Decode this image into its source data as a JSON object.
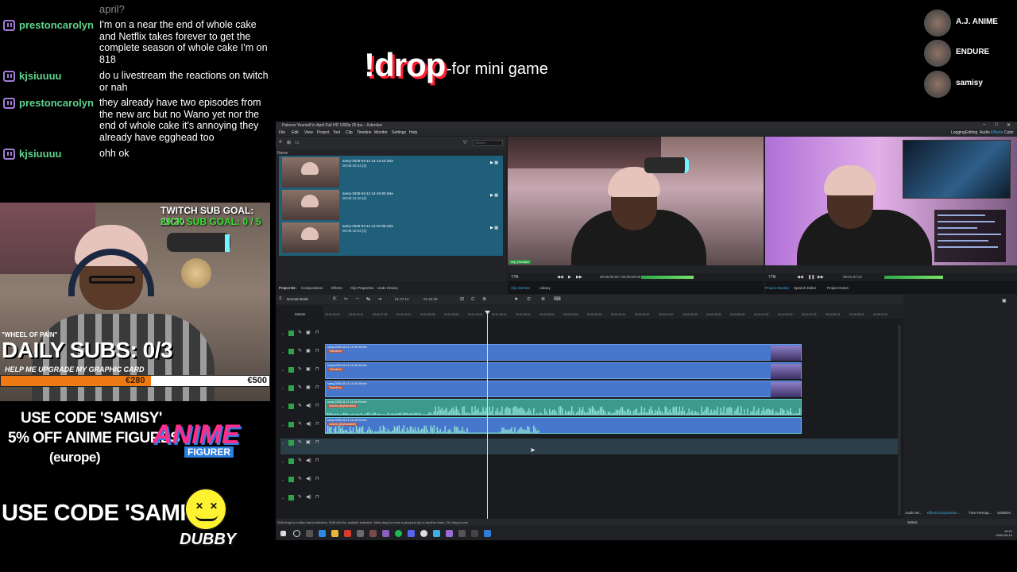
{
  "chat": {
    "faded_text": "april?",
    "messages": [
      {
        "user": "prestoncarolyn",
        "text": "I'm on a near the end of whole cake and Netflix takes forever to get the complete season of whole cake I'm on 818"
      },
      {
        "user": "kjsiuuuu",
        "text": "do u livestream the reactions on twitch or nah"
      },
      {
        "user": "prestoncarolyn",
        "text": "they already have two episodes from the new arc but no Wano yet nor the end of whole cake it's annoying they already have egghead too"
      },
      {
        "user": "kjsiuuuu",
        "text": "ohh ok"
      }
    ]
  },
  "overlay": {
    "twitch_goal": "TWITCH SUB GOAL: 29/30",
    "kick_goal": "KICK SUB GOAL: 0 / 5",
    "wheel_label": "\"WHEEL OF PAIN\"",
    "daily_subs": "DAILY SUBS: 0/3",
    "gpu_label": "HELP ME UPGRADE MY GRAPHIC CARD",
    "gpu_current": "€280",
    "gpu_goal": "€500",
    "gpu_progress": 0.56,
    "promo1_line1": "USE CODE 'SAMISY'",
    "promo1_line2": "5% OFF ANIME FIGURES",
    "promo1_line3": "(europe)",
    "anime_logo": "ANIME",
    "anime_logo_sub": "FIGURER",
    "promo2": "USE CODE 'SAMISY'",
    "dubby_logo": "DUBBY"
  },
  "banner": {
    "command": "!drop",
    "description": "-for mini game"
  },
  "team": [
    {
      "name": "A.J. ANIME"
    },
    {
      "name": "ENDURE"
    },
    {
      "name": "samisy"
    }
  ],
  "editor": {
    "title": "Patreon Yourself in April Full HD 1080p 25 fps – Kdenlive",
    "menu": [
      "File",
      "Edit",
      "View",
      "Project",
      "Tool",
      "Clip",
      "Timeline",
      "Monitor",
      "Settings",
      "Help"
    ],
    "layouts": [
      "Logging",
      "Editing",
      "Audio",
      "Effects",
      "Color"
    ],
    "active_layout": "Effects",
    "search_placeholder": "Search...",
    "bin_header": "Name",
    "bin_items": [
      {
        "name": "samy-2026-04-12 14-13-10.mkv",
        "duration": "00:08:32:24 [4]"
      },
      {
        "name": "samy-2026-04-12 14-15-00.mkv",
        "duration": "00:06:12:10 [4]"
      },
      {
        "name": "samy-2026-04-12 14-04-09.mkv",
        "duration": "00:05:40:02 [4]"
      }
    ],
    "bin_tabs": [
      "Project Bin",
      "Compositions",
      "Effects",
      "Clip Properties",
      "Undo History"
    ],
    "clip_monitor": {
      "zoom": "77fit",
      "timecode": "00:00:00:00 / 00:00:00:00",
      "badge": "clip_Duration"
    },
    "project_monitor": {
      "zoom": "77fit",
      "timecode": "00:01:37:14"
    },
    "monitor_tabs_left": [
      "Clip Monitor",
      "Library"
    ],
    "monitor_tabs_right": [
      "Project Monitor",
      "Speech Editor",
      "Project Notes"
    ],
    "timeline_mode": "Normal Mode",
    "timecodes": [
      "01:37:14",
      "01:32:28"
    ],
    "master_label": "Master",
    "ruler_ticks": [
      "00:00:00:00",
      "00:00:13:11",
      "00:00:27:09",
      "00:00:41:07",
      "00:00:55:05",
      "00:01:09:03",
      "00:01:23:01",
      "00:01:36:24",
      "00:01:50:22",
      "00:02:04:20",
      "00:02:18:18",
      "00:02:32:16",
      "00:02:46:14",
      "00:03:00:12",
      "00:03:14:10",
      "00:03:28:08",
      "00:03:42:06",
      "00:03:56:04",
      "00:04:10:02",
      "00:04:24:00",
      "00:04:37:23",
      "00:04:51:21",
      "00:05:05:19",
      "00:05:19:17"
    ],
    "clips": [
      {
        "name": "samy-2026-04-12 14-04-09.mkv",
        "fx": "Transform"
      },
      {
        "name": "samy-2026-04-12 14-04-09.mkv",
        "fx": "Transform"
      },
      {
        "name": "samy-2026-04-12 14-04-09.mkv",
        "fx": "Transform"
      },
      {
        "name": "samy-2026-04-12 14-04-09.mkv",
        "fx": "Volume (keyframable)"
      },
      {
        "name": "samy-2026-04-12 14-04-09.mkv",
        "fx": "Volume (keyframable)"
      }
    ],
    "right_tabs": [
      "Audio Mi...",
      "Effect/Composition...",
      "Time Remap...",
      "Subtitles"
    ],
    "status": "Shift drag for rubber-band selection, Shift click for multiple selection, Meta drag to move a grouped clip to another track, Ctrl drag to pan",
    "status_select": "Select",
    "clock_time": "16:21",
    "clock_date": "2026-04-12"
  }
}
